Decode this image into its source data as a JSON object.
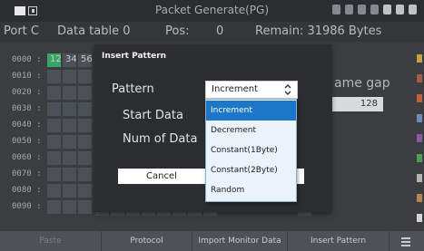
{
  "status_bar": {
    "title": "Packet Generate(PG)"
  },
  "header": {
    "port": "Port C",
    "table": "Data table 0",
    "pos_label": "Pos:",
    "pos_value": "0",
    "remain": "Remain: 31986 Bytes"
  },
  "hex_table": {
    "addresses": [
      "0000 :",
      "0010 :",
      "0020 :",
      "0030 :",
      "0040 :",
      "0050 :",
      "0060 :",
      "0070 :",
      "0080 :",
      "0090 :"
    ],
    "first_row_values": [
      "12",
      "34",
      "56"
    ]
  },
  "right_panel": {
    "frame_gap_label": "ame gap",
    "frame_gap_value": "128"
  },
  "dialog": {
    "title": "Insert Pattern",
    "pattern_label": "Pattern",
    "pattern_value": "Increment",
    "start_data_label": "Start Data",
    "num_data_label": "Num of Data",
    "cancel_label": "Cancel",
    "dropdown_options": [
      "Increment",
      "Decrement",
      "Constant(1Byte)",
      "Constant(2Byte)",
      "Random"
    ],
    "selected_option": "Increment"
  },
  "bottom_bar": {
    "buttons": [
      "Paste",
      "Protocol",
      "Import Monitor Data",
      "Insert Pattern"
    ]
  },
  "colors": {
    "accent": "#1d77c9",
    "selected_cell": "#38a567"
  }
}
